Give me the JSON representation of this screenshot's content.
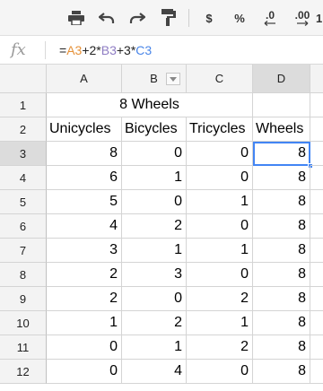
{
  "toolbar": {
    "currency_label": "$",
    "percent_label": "%",
    "decrease_decimal_label": ".0",
    "increase_decimal_label": ".00",
    "more_formats_label": "1"
  },
  "formula_bar": {
    "fx_label": "fx",
    "formula_parts": [
      "=",
      "A3",
      "+2*",
      "B3",
      "+3*",
      "C3"
    ]
  },
  "columns": [
    "A",
    "B",
    "C",
    "D"
  ],
  "rows": [
    {
      "n": "1",
      "cells": [
        "",
        "8 Wheels",
        "",
        ""
      ]
    },
    {
      "n": "2",
      "cells": [
        "Unicycles",
        "Bicycles",
        "Tricycles",
        "Wheels"
      ]
    },
    {
      "n": "3",
      "cells": [
        "8",
        "0",
        "0",
        "8"
      ]
    },
    {
      "n": "4",
      "cells": [
        "6",
        "1",
        "0",
        "8"
      ]
    },
    {
      "n": "5",
      "cells": [
        "5",
        "0",
        "1",
        "8"
      ]
    },
    {
      "n": "6",
      "cells": [
        "4",
        "2",
        "0",
        "8"
      ]
    },
    {
      "n": "7",
      "cells": [
        "3",
        "1",
        "1",
        "8"
      ]
    },
    {
      "n": "8",
      "cells": [
        "2",
        "3",
        "0",
        "8"
      ]
    },
    {
      "n": "9",
      "cells": [
        "2",
        "0",
        "2",
        "8"
      ]
    },
    {
      "n": "10",
      "cells": [
        "1",
        "2",
        "1",
        "8"
      ]
    },
    {
      "n": "11",
      "cells": [
        "0",
        "1",
        "2",
        "8"
      ]
    },
    {
      "n": "12",
      "cells": [
        "0",
        "4",
        "0",
        "8"
      ]
    }
  ],
  "active_cell": "D3",
  "colors": {
    "selection": "#4285f4",
    "ref_a": "#e69138",
    "ref_b": "#8e7cc3",
    "ref_c": "#4a86e8"
  }
}
